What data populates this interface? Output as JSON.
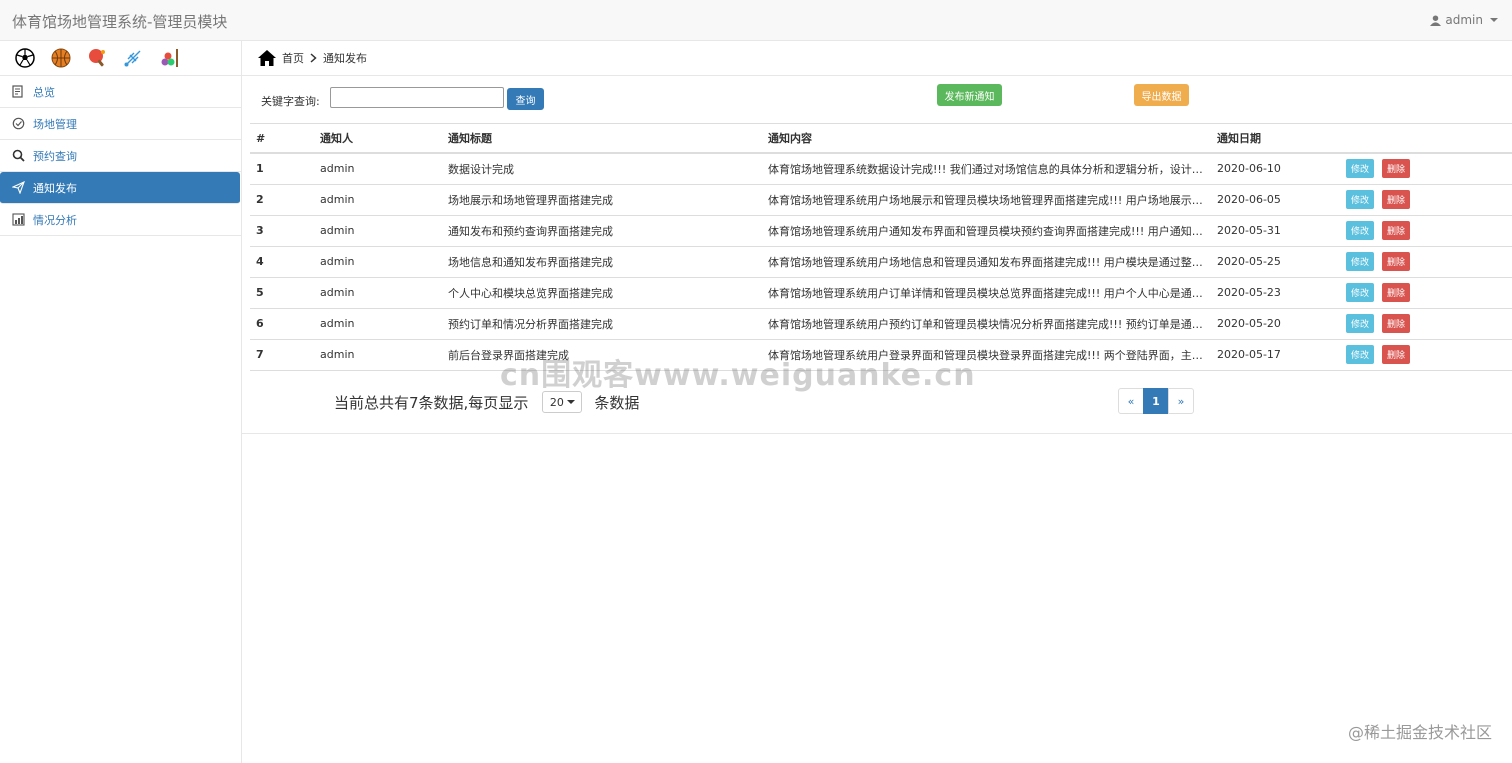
{
  "header": {
    "title": "体育馆场地管理系统-管理员模块",
    "user": "admin"
  },
  "sidebar": {
    "sport_icons": [
      "soccer-ball-icon",
      "basketball-icon",
      "ping-pong-icon",
      "badminton-icon",
      "billiards-icon"
    ],
    "items": [
      {
        "label": "总览",
        "icon": "dashboard-icon"
      },
      {
        "label": "场地管理",
        "icon": "check-circle-icon"
      },
      {
        "label": "预约查询",
        "icon": "search-icon"
      },
      {
        "label": "通知发布",
        "icon": "paper-plane-icon",
        "active": true
      },
      {
        "label": "情况分析",
        "icon": "chart-report-icon"
      }
    ]
  },
  "breadcrumb": {
    "home": "首页",
    "current": "通知发布"
  },
  "toolbar": {
    "keyword_label": "关键字查询:",
    "keyword_value": "",
    "search_label": "查询",
    "publish_label": "发布新通知",
    "export_label": "导出数据"
  },
  "table": {
    "headers": [
      "#",
      "通知人",
      "通知标题",
      "通知内容",
      "通知日期",
      ""
    ],
    "edit_label": "修改",
    "delete_label": "删除",
    "rows": [
      {
        "id": "1",
        "author": "admin",
        "title": "数据设计完成",
        "content": "体育馆场地管理系统数据设计完成!!! 我们通过对场馆信息的具体分析和逻辑分析，设计…",
        "date": "2020-06-10"
      },
      {
        "id": "2",
        "author": "admin",
        "title": "场地展示和场地管理界面搭建完成",
        "content": "体育馆场地管理系统用户场地展示和管理员模块场地管理界面搭建完成!!! 用户场地展示…",
        "date": "2020-06-05"
      },
      {
        "id": "3",
        "author": "admin",
        "title": "通知发布和预约查询界面搭建完成",
        "content": "体育馆场地管理系统用户通知发布界面和管理员模块预约查询界面搭建完成!!! 用户通知…",
        "date": "2020-05-31"
      },
      {
        "id": "4",
        "author": "admin",
        "title": "场地信息和通知发布界面搭建完成",
        "content": "体育馆场地管理系统用户场地信息和管理员通知发布界面搭建完成!!! 用户模块是通过整…",
        "date": "2020-05-25"
      },
      {
        "id": "5",
        "author": "admin",
        "title": "个人中心和模块总览界面搭建完成",
        "content": "体育馆场地管理系统用户订单详情和管理员模块总览界面搭建完成!!! 用户个人中心是通…",
        "date": "2020-05-23"
      },
      {
        "id": "6",
        "author": "admin",
        "title": "预约订单和情况分析界面搭建完成",
        "content": "体育馆场地管理系统用户预约订单和管理员模块情况分析界面搭建完成!!! 预约订单是通…",
        "date": "2020-05-20"
      },
      {
        "id": "7",
        "author": "admin",
        "title": "前后台登录界面搭建完成",
        "content": "体育馆场地管理系统用户登录界面和管理员模块登录界面搭建完成!!! 两个登陆界面，主…",
        "date": "2020-05-17"
      }
    ]
  },
  "pagination": {
    "summary_prefix": "当前总共有7条数据,每页显示",
    "page_size": "20",
    "summary_suffix": "条数据",
    "prev": "«",
    "current": "1",
    "next": "»"
  },
  "watermark": "cn围观客www.weiguanke.cn",
  "corner_watermark": "@稀土掘金技术社区",
  "colors": {
    "primary": "#337ab7",
    "success": "#5cb85c",
    "warning": "#f0ad4e",
    "info": "#5bc0de",
    "danger": "#d9534f"
  }
}
